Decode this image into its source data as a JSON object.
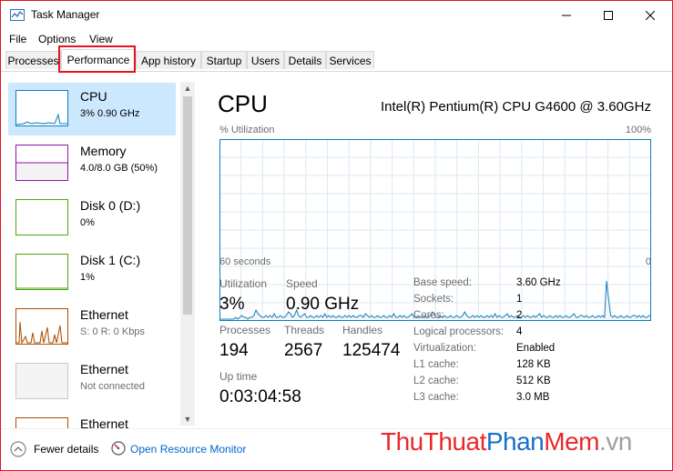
{
  "window": {
    "title": "Task Manager"
  },
  "menu": {
    "items": [
      "File",
      "Options",
      "View"
    ]
  },
  "tabs": [
    "Processes",
    "Performance",
    "App history",
    "Startup",
    "Users",
    "Details",
    "Services"
  ],
  "active_tab": "Performance",
  "sidebar": {
    "items": [
      {
        "name": "CPU",
        "sub": "3% 0.90 GHz",
        "color": "#117dbb"
      },
      {
        "name": "Memory",
        "sub": "4.0/8.0 GB (50%)",
        "color": "#8b12ae"
      },
      {
        "name": "Disk 0 (D:)",
        "sub": "0%",
        "color": "#4da60c"
      },
      {
        "name": "Disk 1 (C:)",
        "sub": "1%",
        "color": "#4da60c"
      },
      {
        "name": "Ethernet",
        "sub": "S: 0 R: 0 Kbps",
        "color": "#a74f01"
      },
      {
        "name": "Ethernet",
        "sub": "Not connected",
        "color": "#a0a0a0"
      },
      {
        "name": "Ethernet",
        "sub": "",
        "color": "#a74f01"
      }
    ]
  },
  "main": {
    "title": "CPU",
    "cpu_model": "Intel(R) Pentium(R) CPU G4600 @ 3.60GHz",
    "graph": {
      "y_label": "% Utilization",
      "y_max_label": "100%",
      "x_left_label": "60 seconds",
      "x_right_label": "0",
      "line_color": "#117dbb",
      "fill_color": "#f1f6fa",
      "grid_color": "#d9eaf4",
      "utilization_percent": [
        1,
        1,
        1,
        1,
        1,
        1,
        1,
        1,
        2,
        1,
        2,
        3,
        2,
        2,
        1,
        2,
        2,
        3,
        6,
        4,
        3,
        2,
        2,
        3,
        2,
        3,
        2,
        4,
        2,
        2,
        3,
        2,
        2,
        3,
        5,
        4,
        2,
        3,
        6,
        3,
        2,
        3,
        4,
        2,
        2,
        3,
        2,
        2,
        3,
        2,
        3,
        2,
        4,
        2,
        3,
        2,
        3,
        2,
        2,
        3,
        2,
        2,
        3,
        2,
        3,
        2,
        3,
        2,
        2,
        3,
        3,
        2,
        4,
        3,
        2,
        3,
        2,
        2,
        3,
        2,
        2,
        3,
        2,
        2,
        3,
        2,
        4,
        2,
        2,
        3,
        2,
        3,
        2,
        2,
        3,
        4,
        2,
        2,
        3,
        2,
        2,
        3,
        2,
        2,
        3,
        5,
        4,
        2,
        2,
        3,
        2,
        3,
        2,
        2,
        3,
        2,
        2,
        3,
        2,
        2,
        3,
        5,
        3,
        2,
        2,
        3,
        2,
        3,
        2,
        3,
        2,
        2,
        3,
        2,
        3,
        2,
        4,
        2,
        3,
        2,
        2,
        3,
        4,
        2,
        3,
        2,
        2,
        3,
        2,
        2,
        3,
        2,
        3,
        2,
        2,
        3,
        2,
        3,
        4,
        2,
        3,
        2,
        2,
        3,
        2,
        2,
        3,
        2,
        3,
        2,
        2,
        3,
        2,
        2,
        3,
        4,
        2,
        2,
        3,
        3,
        2,
        3,
        2,
        2,
        3,
        2,
        2,
        3,
        2,
        3,
        2,
        22,
        12,
        3,
        2,
        3,
        2,
        2,
        3,
        2,
        2,
        3,
        2,
        2,
        3,
        3,
        2,
        3,
        2,
        3,
        2,
        2,
        3,
        3
      ]
    },
    "stats": {
      "utilization": {
        "label": "Utilization",
        "value": "3%"
      },
      "speed": {
        "label": "Speed",
        "value": "0.90 GHz"
      },
      "processes": {
        "label": "Processes",
        "value": "194"
      },
      "threads": {
        "label": "Threads",
        "value": "2567"
      },
      "handles": {
        "label": "Handles",
        "value": "125474"
      },
      "uptime": {
        "label": "Up time",
        "value": "0:03:04:58"
      }
    },
    "specs": [
      {
        "label": "Base speed:",
        "value": "3.60 GHz"
      },
      {
        "label": "Sockets:",
        "value": "1"
      },
      {
        "label": "Cores:",
        "value": "2"
      },
      {
        "label": "Logical processors:",
        "value": "4"
      },
      {
        "label": "Virtualization:",
        "value": "Enabled"
      },
      {
        "label": "L1 cache:",
        "value": "128 KB"
      },
      {
        "label": "L2 cache:",
        "value": "512 KB"
      },
      {
        "label": "L3 cache:",
        "value": "3.0 MB"
      }
    ]
  },
  "footer": {
    "fewer_details": "Fewer details",
    "open_resource_monitor": "Open Resource Monitor"
  },
  "watermark": {
    "part1": "Thu",
    "part2": "Thuat",
    "part3": "Phan",
    "part4": "Mem",
    "part5": ".vn",
    "color_red": "#e8292a",
    "color_blue": "#1a6fc9",
    "color_gray": "#9e9e9e"
  }
}
